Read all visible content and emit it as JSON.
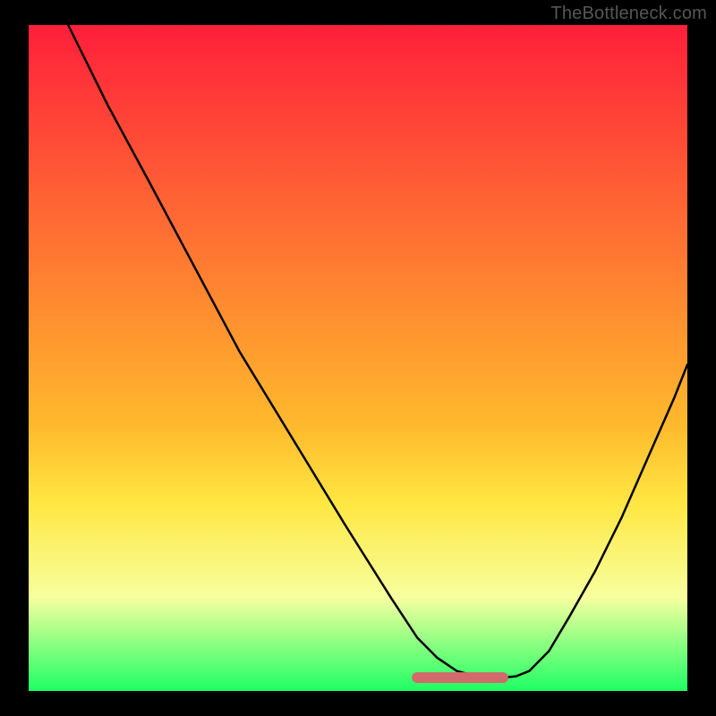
{
  "watermark": "TheBottleneck.com",
  "colors": {
    "watermark_text": "#565656",
    "border": "#000000",
    "gradient_top": "#ff1f3a",
    "gradient_60": "#ffb92c",
    "gradient_72": "#ffe743",
    "gradient_86": "#f7ff9f",
    "gradient_bottom": "#1eff64",
    "curve": "#000000",
    "marker": "#d2696a"
  },
  "chart_data": {
    "type": "line",
    "title": "",
    "xlabel": "",
    "ylabel": "",
    "xlim": [
      0,
      100
    ],
    "ylim": [
      0,
      100
    ],
    "series": [
      {
        "name": "curve",
        "x": [
          6,
          12,
          18,
          25,
          32,
          40,
          48,
          55,
          59,
          62,
          65,
          68,
          70,
          72,
          74,
          76,
          79,
          82,
          86,
          90,
          94,
          98,
          100
        ],
        "y": [
          100,
          88,
          77,
          64,
          51,
          38,
          25,
          14,
          8,
          5,
          3,
          2.2,
          2,
          2,
          2.2,
          3,
          6,
          11,
          18,
          26,
          35,
          44,
          49
        ]
      }
    ],
    "marker_region": {
      "x": [
        59,
        72
      ],
      "y_baseline": 2,
      "thickness": 2.5
    },
    "background_gradient": {
      "type": "linear-vertical",
      "stops": [
        {
          "offset": 0.0,
          "color": "#ff1f3a"
        },
        {
          "offset": 0.6,
          "color": "#ffb92c"
        },
        {
          "offset": 0.72,
          "color": "#ffe743"
        },
        {
          "offset": 0.86,
          "color": "#f7ff9f"
        },
        {
          "offset": 1.0,
          "color": "#1eff64"
        }
      ]
    }
  }
}
